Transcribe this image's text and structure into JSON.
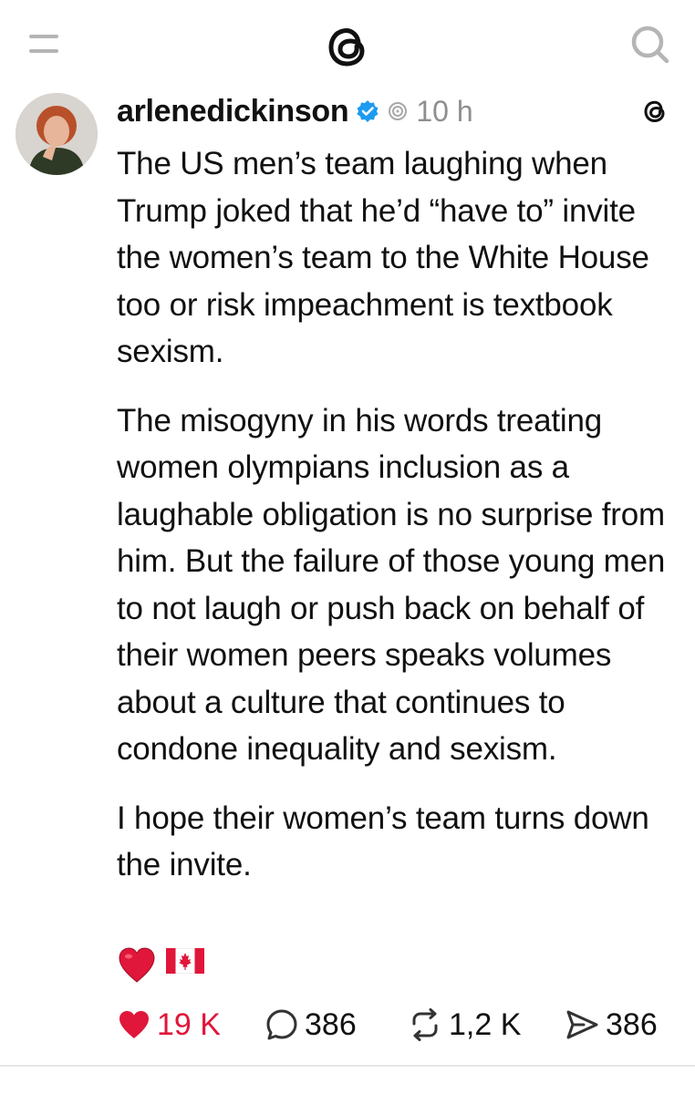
{
  "topbar": {
    "menu_icon": "menu-icon",
    "logo_icon": "threads-logo-icon",
    "search_icon": "search-icon"
  },
  "post": {
    "username": "arlenedickinson",
    "timestamp": "10 h",
    "paragraphs": [
      "The US men’s team laughing when Trump joked that he’d “have to” invite the women’s team to the White House too or risk impeachment is textbook sexism.",
      "The misogyny in his words treating women olympians inclusion as a laughable obligation is no surprise from him. But the failure of those young men to not laugh or push back on behalf of their women peers speaks volumes about a culture that continues to condone inequality and sexism.",
      "I hope their women’s team turns down the invite."
    ],
    "emojis": [
      "❤️",
      "🇨🇦"
    ],
    "actions": {
      "likes": "19 K",
      "replies": "386",
      "reposts": "1,2 K",
      "shares": "386"
    }
  },
  "colors": {
    "like_red": "#e0163a",
    "verified_blue": "#1d9bf0",
    "muted_gray": "#8e8e8e"
  }
}
